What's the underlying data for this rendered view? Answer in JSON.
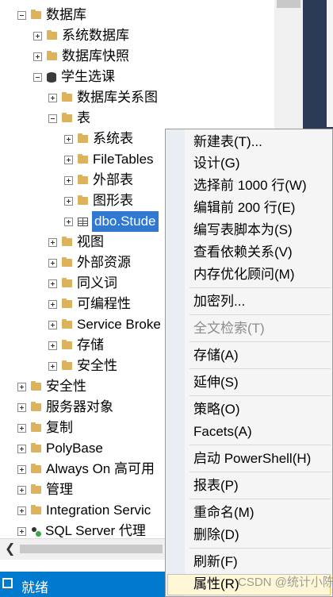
{
  "tree": {
    "items": [
      {
        "label": "数据库",
        "icon": "folder-icon",
        "expander": "minus"
      },
      {
        "label": "系统数据库",
        "icon": "folder-icon",
        "expander": "plus"
      },
      {
        "label": "数据库快照",
        "icon": "folder-icon",
        "expander": "plus"
      },
      {
        "label": "学生选课",
        "icon": "database-icon",
        "expander": "minus"
      },
      {
        "label": "数据库关系图",
        "icon": "folder-icon",
        "expander": "plus"
      },
      {
        "label": "表",
        "icon": "folder-icon",
        "expander": "minus"
      },
      {
        "label": "系统表",
        "icon": "folder-icon",
        "expander": "plus"
      },
      {
        "label": "FileTables",
        "icon": "folder-icon",
        "expander": "plus"
      },
      {
        "label": "外部表",
        "icon": "folder-icon",
        "expander": "plus"
      },
      {
        "label": "图形表",
        "icon": "folder-icon",
        "expander": "plus"
      },
      {
        "label": "dbo.Stude",
        "icon": "table-icon",
        "expander": "plus",
        "selected": true
      },
      {
        "label": "视图",
        "icon": "folder-icon",
        "expander": "plus"
      },
      {
        "label": "外部资源",
        "icon": "folder-icon",
        "expander": "plus"
      },
      {
        "label": "同义词",
        "icon": "folder-icon",
        "expander": "plus"
      },
      {
        "label": "可编程性",
        "icon": "folder-icon",
        "expander": "plus"
      },
      {
        "label": "Service Broke",
        "icon": "folder-icon",
        "expander": "plus"
      },
      {
        "label": "存储",
        "icon": "folder-icon",
        "expander": "plus"
      },
      {
        "label": "安全性",
        "icon": "folder-icon",
        "expander": "plus"
      },
      {
        "label": "安全性",
        "icon": "folder-icon",
        "expander": "plus"
      },
      {
        "label": "服务器对象",
        "icon": "folder-icon",
        "expander": "plus"
      },
      {
        "label": "复制",
        "icon": "folder-icon",
        "expander": "plus"
      },
      {
        "label": "PolyBase",
        "icon": "folder-icon",
        "expander": "plus"
      },
      {
        "label": "Always On 高可用",
        "icon": "folder-icon",
        "expander": "plus"
      },
      {
        "label": "管理",
        "icon": "folder-icon",
        "expander": "plus"
      },
      {
        "label": "Integration Servic",
        "icon": "folder-icon",
        "expander": "plus"
      },
      {
        "label": "SQL Server 代理",
        "icon": "sql-agent-icon",
        "expander": "plus"
      }
    ]
  },
  "context_menu": {
    "items": [
      {
        "label": "新建表(T)..."
      },
      {
        "label": "设计(G)"
      },
      {
        "label": "选择前 1000 行(W)"
      },
      {
        "label": "编辑前 200 行(E)"
      },
      {
        "label": "编写表脚本为(S)"
      },
      {
        "label": "查看依赖关系(V)"
      },
      {
        "label": "内存优化顾问(M)"
      },
      {
        "label": "加密列..."
      },
      {
        "label": "全文检索(T)",
        "disabled": true
      },
      {
        "label": "存储(A)"
      },
      {
        "label": "延伸(S)"
      },
      {
        "label": "策略(O)"
      },
      {
        "label": "Facets(A)"
      },
      {
        "label": "启动 PowerShell(H)"
      },
      {
        "label": "报表(P)"
      },
      {
        "label": "重命名(M)"
      },
      {
        "label": "删除(D)"
      },
      {
        "label": "刷新(F)"
      },
      {
        "label": "属性(R)",
        "highlighted": true
      }
    ]
  },
  "status_bar": {
    "text": "就绪"
  },
  "watermark": "CSDN @统计小陈",
  "colors": {
    "status_bar": "#007acc",
    "selection": "#3078d0",
    "folder": "#dcb35c",
    "menu_bg": "#f5f5f5"
  }
}
